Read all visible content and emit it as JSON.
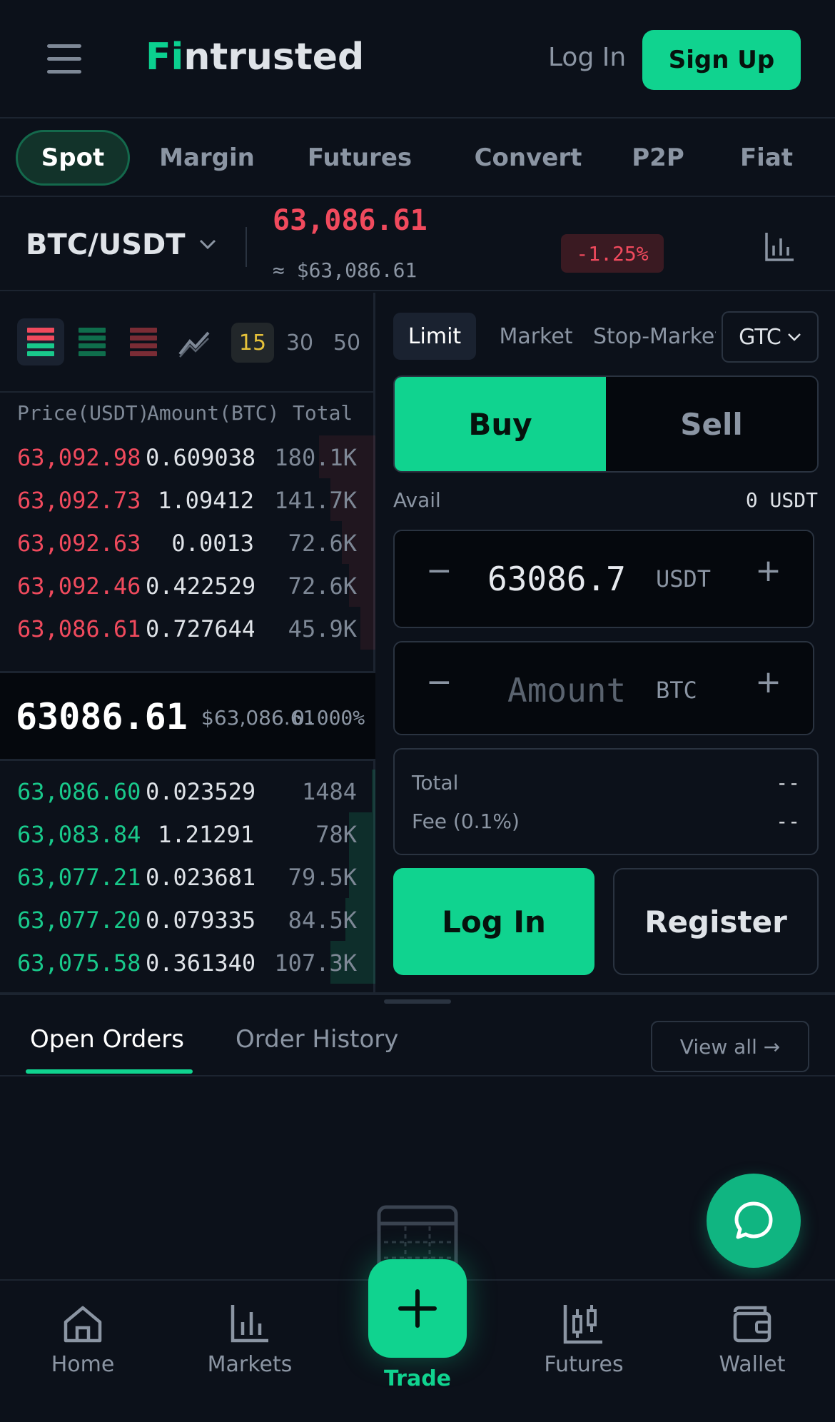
{
  "header": {
    "brand_prefix": "Fi",
    "brand_suffix": "ntrusted",
    "login_label": "Log In",
    "signup_label": "Sign Up"
  },
  "product_tabs": [
    "Spot",
    "Margin",
    "Futures",
    "Convert",
    "P2P",
    "Fiat"
  ],
  "pair": {
    "name": "BTC/USDT",
    "last_price": "63,086.61",
    "last_price_usd": "≈ $63,086.61",
    "change": "-1.25%"
  },
  "orderbook": {
    "depth_options": [
      "15",
      "30",
      "50"
    ],
    "columns": [
      "Price(USDT)",
      "Amount(BTC)",
      "Total"
    ],
    "asks": [
      {
        "price": "63,092.98",
        "amount": "0.609038",
        "total": "180.1K",
        "depth": 0.15
      },
      {
        "price": "63,092.73",
        "amount": "1.09412",
        "total": "141.7K",
        "depth": 0.12
      },
      {
        "price": "63,092.63",
        "amount": "0.0013",
        "total": "72.6K",
        "depth": 0.09
      },
      {
        "price": "63,092.46",
        "amount": "0.422529",
        "total": "72.6K",
        "depth": 0.07
      },
      {
        "price": "63,086.61",
        "amount": "0.727644",
        "total": "45.9K",
        "depth": 0.04
      }
    ],
    "mid": {
      "price": "63086.61",
      "usd": "$63,086.61",
      "pct": "0.000%"
    },
    "bids": [
      {
        "price": "63,086.60",
        "amount": "0.023529",
        "total": "1484",
        "depth": 0.01
      },
      {
        "price": "63,083.84",
        "amount": "1.21291",
        "total": "78K",
        "depth": 0.07
      },
      {
        "price": "63,077.21",
        "amount": "0.023681",
        "total": "79.5K",
        "depth": 0.07
      },
      {
        "price": "63,077.20",
        "amount": "0.079335",
        "total": "84.5K",
        "depth": 0.08
      },
      {
        "price": "63,075.58",
        "amount": "0.361340",
        "total": "107.3K",
        "depth": 0.12
      }
    ]
  },
  "order_form": {
    "order_types": [
      "Limit",
      "Market",
      "Stop-Market"
    ],
    "tif": "GTC",
    "buy_label": "Buy",
    "sell_label": "Sell",
    "avail_label": "Avail",
    "avail_value": "0 USDT",
    "price_value": "63086.7",
    "price_unit": "USDT",
    "amount_placeholder": "Amount",
    "amount_unit": "BTC",
    "minus": "−",
    "plus": "+",
    "total_label": "Total",
    "total_value": "--",
    "fee_label": "Fee (0.1%)",
    "fee_value": "--",
    "login_label": "Log In",
    "register_label": "Register"
  },
  "orders": {
    "tabs": [
      "Open Orders",
      "Order History"
    ],
    "view_all": "View all →"
  },
  "bottom_nav": {
    "home": "Home",
    "markets": "Markets",
    "trade": "Trade",
    "futures": "Futures",
    "wallet": "Wallet"
  },
  "colors": {
    "accent": "#10d38f",
    "ask": "#f04a5d",
    "bid": "#19c98b",
    "background": "#0c111a"
  }
}
